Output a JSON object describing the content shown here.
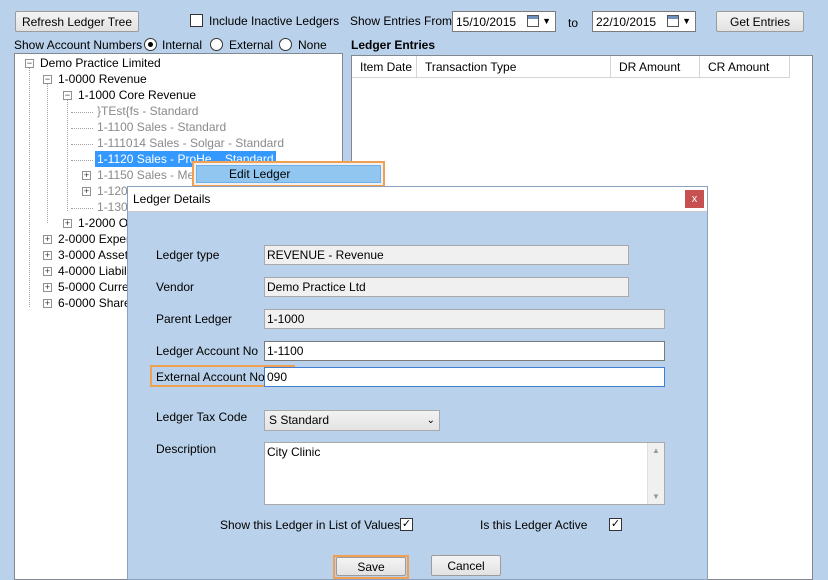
{
  "toolbar": {
    "refresh_label": "Refresh Ledger Tree",
    "include_inactive_label": "Include Inactive Ledgers",
    "include_inactive_checked": false,
    "show_entries_from_label": "Show Entries From",
    "from_date": "15/10/2015",
    "to_label": "to",
    "to_date": "22/10/2015",
    "get_entries_label": "Get Entries"
  },
  "account_numbers": {
    "label": "Show Account Numbers",
    "options": [
      "Internal",
      "External",
      "None"
    ],
    "selected": "Internal"
  },
  "tree": {
    "root": "Demo Practice Limited",
    "nodes": [
      {
        "label": "1-0000 Revenue"
      },
      {
        "label": "1-1000 Core Revenue"
      },
      {
        "label": "}TEst{fs - Standard"
      },
      {
        "label": "1-1100 Sales - Standard"
      },
      {
        "label": "1-111014 Sales - Solgar - Standard"
      },
      {
        "label": "1-1120 Sales - ProHe... Standard"
      },
      {
        "label": "1-1150 Sales - Meta"
      },
      {
        "label": "1-1200"
      },
      {
        "label": "1-1300"
      },
      {
        "label": "1-2000 Oth"
      },
      {
        "label": "2-0000 Expens"
      },
      {
        "label": "3-0000 Assets"
      },
      {
        "label": "4-0000 Liabiliti"
      },
      {
        "label": "5-0000 Current"
      },
      {
        "label": "6-0000 Shareh"
      }
    ]
  },
  "ledger_entries": {
    "title": "Ledger Entries",
    "columns": [
      "Item Date",
      "Transaction Type",
      "DR Amount",
      "CR Amount"
    ]
  },
  "context_menu": {
    "edit_ledger": "Edit Ledger"
  },
  "dialog": {
    "title": "Ledger Details",
    "close_glyph": "x",
    "ledger_type_label": "Ledger type",
    "ledger_type_value": "REVENUE - Revenue",
    "vendor_label": "Vendor",
    "vendor_value": "Demo Practice Ltd",
    "parent_ledger_label": "Parent Ledger",
    "parent_ledger_value": "1-1000",
    "account_no_label": "Ledger Account No",
    "account_no_value": "1-1100",
    "external_no_label": "External Account No",
    "external_no_value": "090",
    "tax_code_label": "Ledger Tax Code",
    "tax_code_value": "S Standard",
    "description_label": "Description",
    "description_value": "City Clinic",
    "show_in_list_label": "Show this Ledger in List of Values",
    "show_in_list_checked": true,
    "active_label": "Is this Ledger Active",
    "active_checked": true,
    "save_label": "Save",
    "cancel_label": "Cancel"
  },
  "colors": {
    "background": "#b9d1ea",
    "selection": "#3399ff",
    "highlight": "#f0a050",
    "menu_hover": "#90c6f0",
    "close_button": "#c75050"
  }
}
